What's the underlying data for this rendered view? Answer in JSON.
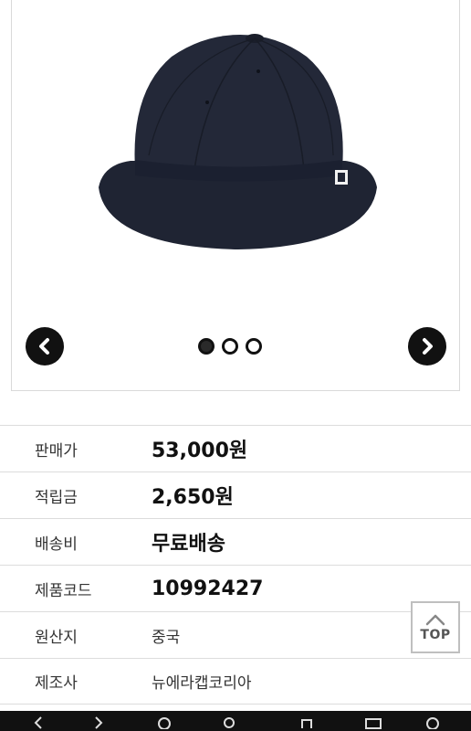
{
  "gallery": {
    "prev_icon": "chevron-left-icon",
    "next_icon": "chevron-right-icon",
    "slides": 3,
    "active_slide": 1
  },
  "product_info": {
    "rows": [
      {
        "label": "판매가",
        "value": "53,000원"
      },
      {
        "label": "적립금",
        "value": "2,650원"
      },
      {
        "label": "배송비",
        "value": "무료배송"
      },
      {
        "label": "제품코드",
        "value": "10992427"
      },
      {
        "label": "원산지",
        "value": "중국"
      },
      {
        "label": "제조사",
        "value": "뉴에라캡코리아"
      }
    ]
  },
  "top_button": {
    "label": "TOP",
    "icon": "chevron-up-icon"
  },
  "system_nav": {
    "icons": [
      "back-icon",
      "forward-icon",
      "refresh-icon",
      "search-icon",
      "tabs-icon",
      "menu-icon"
    ]
  },
  "colors": {
    "hat": "#1f2433",
    "border": "#dcdcdc",
    "nav_button": "#111111"
  }
}
